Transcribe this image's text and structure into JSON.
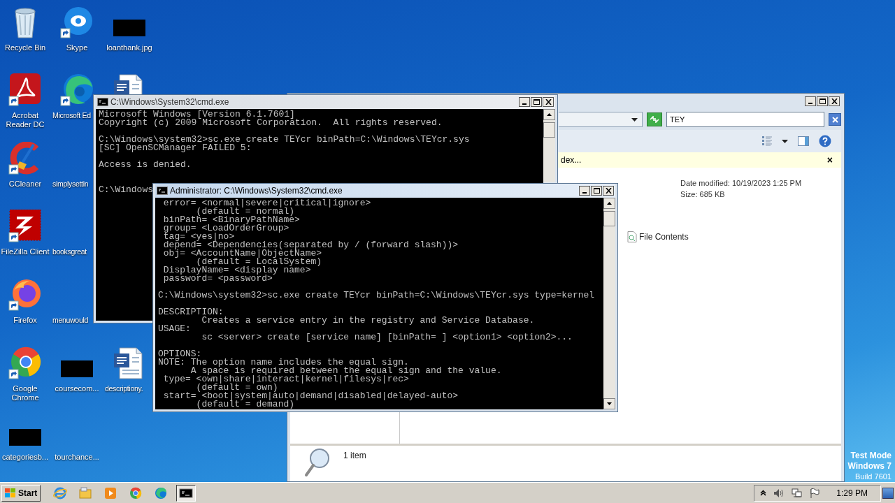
{
  "desktop": {
    "columns": [
      [
        {
          "label": "Recycle Bin",
          "kind": "recycle_bin",
          "shortcut": false
        },
        {
          "label": "Acrobat Reader DC",
          "kind": "acrobat",
          "shortcut": true
        },
        {
          "label": "CCleaner",
          "kind": "ccleaner",
          "shortcut": true
        },
        {
          "label": "FileZilla Client",
          "kind": "filezilla",
          "shortcut": true
        },
        {
          "label": "Firefox",
          "kind": "firefox",
          "shortcut": true
        },
        {
          "label": "Google Chrome",
          "kind": "chrome",
          "shortcut": true
        },
        {
          "label": "categoriesb...",
          "kind": "redacted"
        }
      ],
      [
        {
          "label": "Skype",
          "kind": "skype",
          "shortcut": true
        },
        {
          "label": "Microsoft Ed",
          "kind": "edge",
          "shortcut": true
        },
        {
          "label": "simplysettin",
          "kind": "blank"
        },
        {
          "label": "booksgreat",
          "kind": "blank"
        },
        {
          "label": "menuwould",
          "kind": "blank"
        },
        {
          "label": "coursecom...",
          "kind": "redacted"
        },
        {
          "label": "tourchance...",
          "kind": "blank"
        }
      ],
      [
        {
          "label": "loanthank.jpg",
          "kind": "redacted"
        },
        {
          "kind": "word_cut"
        },
        {
          "label": "descriptiony.",
          "kind": "word",
          "shortcut": false
        }
      ]
    ]
  },
  "explorer": {
    "search": {
      "value": "TEY"
    },
    "info_bar": {
      "text": "dex...",
      "close": "×"
    },
    "details": {
      "date_modified": "Date modified: 10/19/2023 1:25 PM",
      "size": "Size: 685 KB"
    },
    "file_contents": "File Contents",
    "status": "1 item"
  },
  "cmd_windows": [
    {
      "title": "C:\\Windows\\System32\\cmd.exe",
      "active": false,
      "text": "Microsoft Windows [Version 6.1.7601]\nCopyright (c) 2009 Microsoft Corporation.  All rights reserved.\n\nC:\\Windows\\system32>sc.exe create TEYcr binPath=C:\\Windows\\TEYcr.sys\n[SC] OpenSCManager FAILED 5:\n\nAccess is denied.\n\n\nC:\\Windows"
    },
    {
      "title": "Administrator: C:\\Windows\\System32\\cmd.exe",
      "active": true,
      "text": " error= <normal|severe|critical|ignore>\n       (default = normal)\n binPath= <BinaryPathName>\n group= <LoadOrderGroup>\n tag= <yes|no>\n depend= <Dependencies(separated by / (forward slash))>\n obj= <AccountName|ObjectName>\n       (default = LocalSystem)\n DisplayName= <display name>\n password= <password>\n\nC:\\Windows\\system32>sc.exe create TEYcr binPath=C:\\Windows\\TEYcr.sys type=kernel\n\nDESCRIPTION:\n        Creates a service entry in the registry and Service Database.\nUSAGE:\n        sc <server> create [service name] [binPath= ] <option1> <option2>...\n\nOPTIONS:\nNOTE: The option name includes the equal sign.\n      A space is required between the equal sign and the value.\n type= <own|share|interact|kernel|filesys|rec>\n       (default = own)\n start= <boot|system|auto|demand|disabled|delayed-auto>\n       (default = demand)"
    }
  ],
  "taskbar": {
    "start": "Start",
    "apps": [
      {
        "kind": "ie",
        "selected": false
      },
      {
        "kind": "explorer",
        "selected": false
      },
      {
        "kind": "media",
        "selected": false
      },
      {
        "kind": "chrome",
        "selected": false
      },
      {
        "kind": "edge",
        "selected": false
      },
      {
        "kind": "cmd",
        "selected": true
      }
    ],
    "clock": "1:29 PM"
  },
  "watermark": [
    "Test Mode",
    "Windows 7",
    "Build 7601"
  ]
}
